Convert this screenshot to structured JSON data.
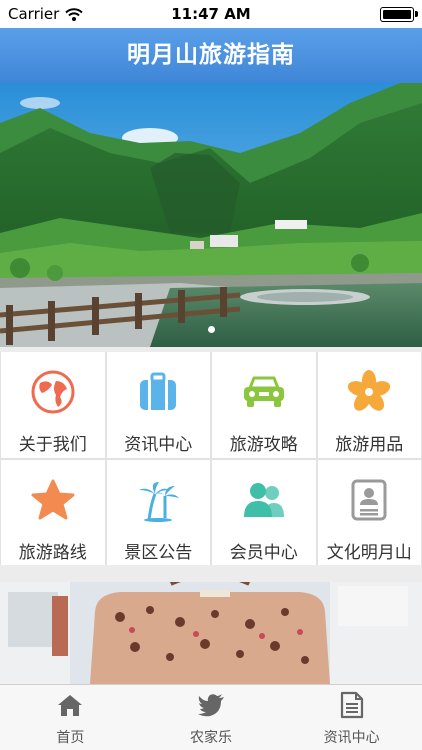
{
  "status": {
    "carrier": "Carrier",
    "time": "11:47 AM"
  },
  "nav": {
    "title": "明月山旅游指南"
  },
  "hero": {
    "slide_count": 1,
    "active_slide": 1
  },
  "grid": [
    {
      "label": "关于我们",
      "icon": "globe-icon",
      "color": "#ef6b50"
    },
    {
      "label": "资讯中心",
      "icon": "suitcase-icon",
      "color": "#5ab4ea"
    },
    {
      "label": "旅游攻略",
      "icon": "car-icon",
      "color": "#8cc63f"
    },
    {
      "label": "旅游用品",
      "icon": "flower-icon",
      "color": "#f5a93a"
    },
    {
      "label": "旅游路线",
      "icon": "star-icon",
      "color": "#f38a50"
    },
    {
      "label": "景区公告",
      "icon": "palm-tree-icon",
      "color": "#4ab0e4"
    },
    {
      "label": "会员中心",
      "icon": "people-icon",
      "color": "#3fbfa8"
    },
    {
      "label": "文化明月山",
      "icon": "id-card-icon",
      "color": "#9a9a9a"
    }
  ],
  "tabs": [
    {
      "label": "首页",
      "icon": "home-icon"
    },
    {
      "label": "农家乐",
      "icon": "bird-icon"
    },
    {
      "label": "资讯中心",
      "icon": "document-icon"
    }
  ]
}
